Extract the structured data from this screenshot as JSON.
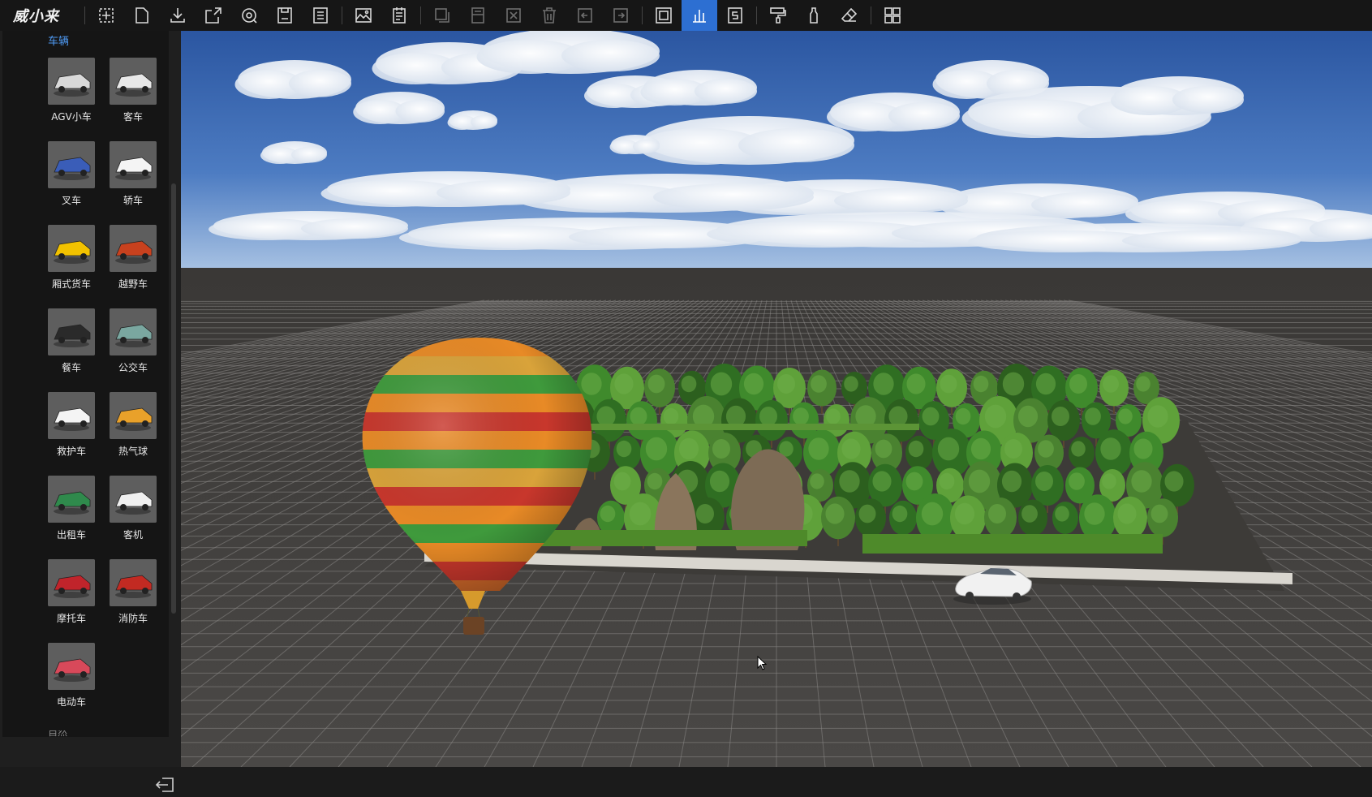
{
  "app": {
    "brand": "威小来"
  },
  "toolbar": {
    "buttons": [
      {
        "icon": "select-box-icon",
        "state": "normal"
      },
      {
        "icon": "new-file-icon",
        "state": "normal"
      },
      {
        "icon": "download-icon",
        "state": "normal"
      },
      {
        "icon": "open-external-icon",
        "state": "normal"
      },
      {
        "icon": "record-view-icon",
        "state": "normal"
      },
      {
        "icon": "save-icon",
        "state": "normal"
      },
      {
        "icon": "save-as-icon",
        "state": "normal"
      },
      {
        "icon": "image-icon",
        "state": "normal"
      },
      {
        "icon": "document-list-icon",
        "state": "normal"
      },
      {
        "icon": "copy-icon",
        "state": "disabled"
      },
      {
        "icon": "paste-icon",
        "state": "disabled"
      },
      {
        "icon": "close-box-icon",
        "state": "disabled"
      },
      {
        "icon": "trash-icon",
        "state": "disabled"
      },
      {
        "icon": "undo-icon",
        "state": "disabled"
      },
      {
        "icon": "redo-icon",
        "state": "disabled"
      },
      {
        "icon": "fit-view-icon",
        "state": "normal"
      },
      {
        "icon": "bar-chart-icon",
        "state": "active"
      },
      {
        "icon": "script-icon",
        "state": "normal"
      },
      {
        "icon": "paint-roller-icon",
        "state": "normal"
      },
      {
        "icon": "bottle-icon",
        "state": "normal"
      },
      {
        "icon": "eraser-icon",
        "state": "normal"
      },
      {
        "icon": "grid-layout-icon",
        "state": "normal"
      }
    ]
  },
  "sidebar": {
    "category": "车辆",
    "next_category": "自然",
    "items": [
      {
        "label": "AGV小车",
        "icon": "agv-cart-icon",
        "color": "#d9d9d9"
      },
      {
        "label": "客车",
        "icon": "coach-bus-icon",
        "color": "#e8e8e8"
      },
      {
        "label": "叉车",
        "icon": "forklift-icon",
        "color": "#3a5db8"
      },
      {
        "label": "轿车",
        "icon": "sedan-icon",
        "color": "#f4f4f4"
      },
      {
        "label": "厢式货车",
        "icon": "box-truck-icon",
        "color": "#f2c200"
      },
      {
        "label": "越野车",
        "icon": "suv-icon",
        "color": "#c8411e"
      },
      {
        "label": "餐车",
        "icon": "food-cart-icon",
        "color": "#2a2a2a"
      },
      {
        "label": "公交车",
        "icon": "city-bus-icon",
        "color": "#7aa7a0"
      },
      {
        "label": "救护车",
        "icon": "ambulance-icon",
        "color": "#f4f4f4"
      },
      {
        "label": "热气球",
        "icon": "hot-air-balloon-icon",
        "color": "#e9a12a"
      },
      {
        "label": "出租车",
        "icon": "taxi-icon",
        "color": "#2f8a4c"
      },
      {
        "label": "客机",
        "icon": "airliner-icon",
        "color": "#f0f0f0"
      },
      {
        "label": "摩托车",
        "icon": "motorcycle-icon",
        "color": "#c0242b"
      },
      {
        "label": "消防车",
        "icon": "fire-truck-icon",
        "color": "#c22a22"
      },
      {
        "label": "电动车",
        "icon": "e-scooter-icon",
        "color": "#d8495a"
      }
    ]
  },
  "viewport": {
    "objects": [
      "hot-air-balloon",
      "park-area",
      "white-sedan"
    ],
    "colors": {
      "sky_top": "#2f5faa",
      "sky_horizon": "#8fb2da",
      "ground": "#454341",
      "grid_line": "#8a8886",
      "hedge": "#4e8a2a",
      "tree_dark": "#2f6e22",
      "tree_light": "#5fa13a",
      "balloon_orange": "#e88a26",
      "balloon_red": "#c8372c",
      "balloon_green": "#3f9a3c"
    }
  }
}
